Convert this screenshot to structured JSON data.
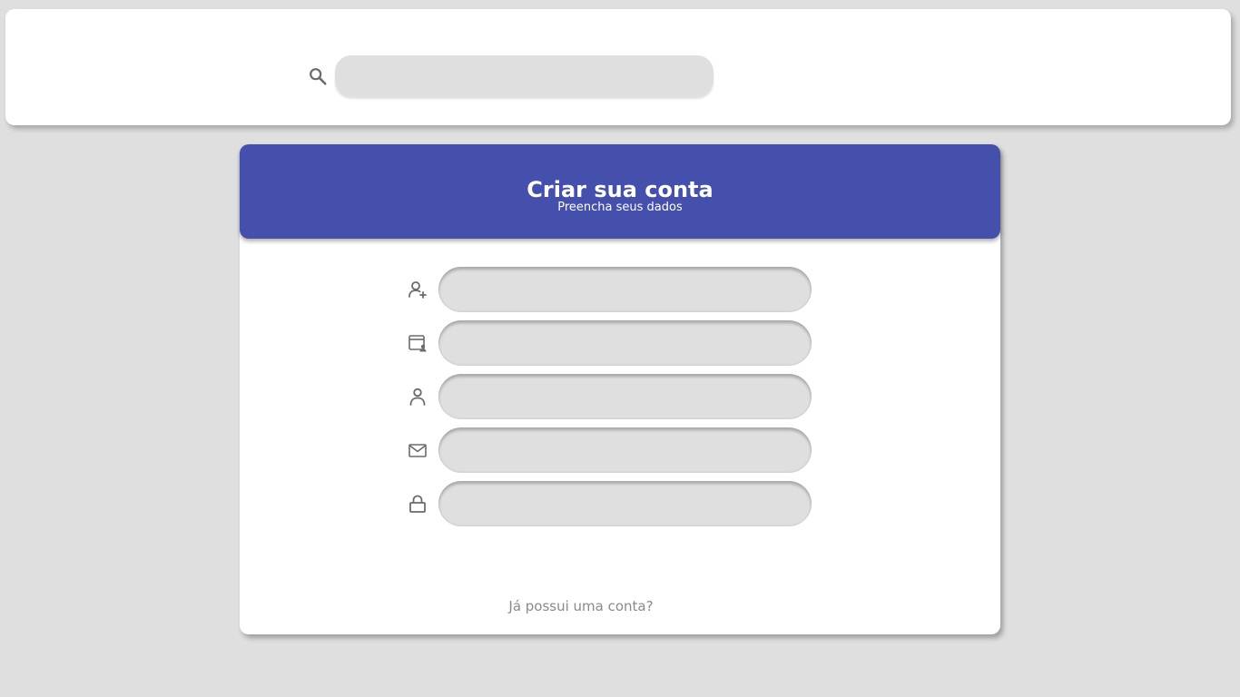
{
  "search": {
    "placeholder": "",
    "value": ""
  },
  "form": {
    "title": "Criar sua conta",
    "subtitle": "Preencha seus dados",
    "fields": [
      {
        "icon": "user-add-icon",
        "placeholder": "",
        "value": ""
      },
      {
        "icon": "id-card-icon",
        "placeholder": "",
        "value": ""
      },
      {
        "icon": "user-icon",
        "placeholder": "",
        "value": ""
      },
      {
        "icon": "mail-icon",
        "placeholder": "",
        "value": ""
      },
      {
        "icon": "lock-icon",
        "placeholder": "",
        "value": ""
      }
    ],
    "login_link": "Já possui uma conta?"
  },
  "colors": {
    "background": "#e0dfe0",
    "header": "#4550ad",
    "icon": "#6b6b6b"
  }
}
